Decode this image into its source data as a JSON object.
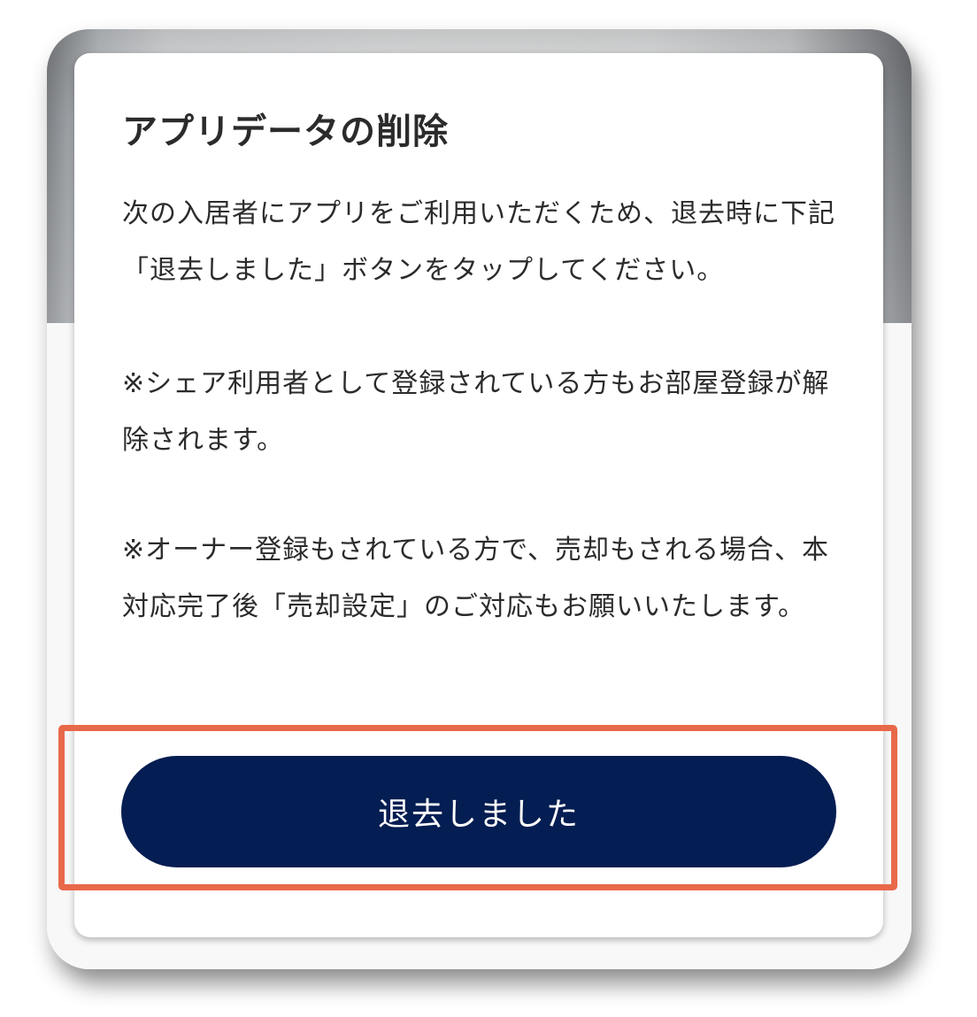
{
  "dialog": {
    "title": "アプリデータの削除",
    "paragraph_1": "次の入居者にアプリをご利用いただくため、退去時に下記「退去しました」ボタンをタップしてください。",
    "paragraph_2": "※シェア利用者として登録されている方もお部屋登録が解除されます。",
    "paragraph_3": "※オーナー登録もされている方で、売却もされる場合、本対応完了後「売却設定」のご対応もお願いいたします。",
    "confirm_button_label": "退去しました"
  },
  "colors": {
    "button_background": "#041d52",
    "button_text": "#ffffff",
    "highlight_border": "#e8694a",
    "body_text": "#2b2b2b"
  }
}
